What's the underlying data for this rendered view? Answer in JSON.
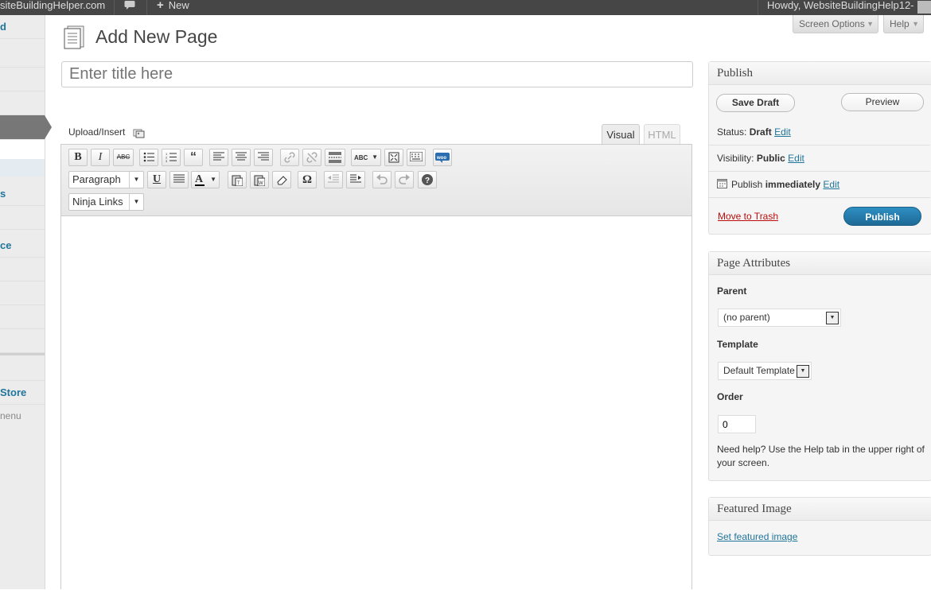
{
  "adminbar": {
    "site": "siteBuildingHelper.com",
    "new_label": "New",
    "howdy": "Howdy, WebsiteBuildingHelp12-"
  },
  "sidebar": {
    "items": [
      {
        "label": "d"
      },
      {
        "label": "s"
      },
      {
        "label": "ce"
      },
      {
        "label": "Store"
      },
      {
        "label": "nenu"
      }
    ]
  },
  "page": {
    "title": "Add New Page",
    "screen_options": "Screen Options",
    "help": "Help",
    "title_placeholder": "Enter title here"
  },
  "editor": {
    "upload_insert": "Upload/Insert",
    "tab_visual": "Visual",
    "tab_html": "HTML",
    "format_select": "Paragraph",
    "ninja_links": "Ninja Links",
    "toolbar_row1": [
      "bold-icon",
      "italic-icon",
      "strikethrough-icon",
      "bullet-list-icon",
      "numbered-list-icon",
      "blockquote-icon",
      "align-left-icon",
      "align-center-icon",
      "align-right-icon",
      "link-icon",
      "unlink-icon",
      "more-tag-icon",
      "spellcheck-icon",
      "fullscreen-icon",
      "kitchen-sink-icon",
      "woo-icon"
    ],
    "toolbar_row2": [
      "underline-icon",
      "justify-icon",
      "text-color-icon",
      "paste-text-icon",
      "paste-word-icon",
      "eraser-icon",
      "omega-icon",
      "outdent-icon",
      "indent-icon",
      "undo-icon",
      "redo-icon",
      "help-icon"
    ]
  },
  "publish": {
    "heading": "Publish",
    "save_draft": "Save Draft",
    "preview": "Preview",
    "status_label": "Status:",
    "status_value": "Draft",
    "visibility_label": "Visibility:",
    "visibility_value": "Public",
    "publish_label": "Publish",
    "publish_value": "immediately",
    "edit": "Edit",
    "move_to_trash": "Move to Trash",
    "publish_button": "Publish"
  },
  "attributes": {
    "heading": "Page Attributes",
    "parent_label": "Parent",
    "parent_value": "(no parent)",
    "template_label": "Template",
    "template_value": "Default Template",
    "order_label": "Order",
    "order_value": "0",
    "help_text": "Need help? Use the Help tab in the upper right of your screen."
  },
  "featured": {
    "heading": "Featured Image",
    "link": "Set featured image"
  },
  "colors": {
    "admin_bar": "#464646",
    "link": "#21759b",
    "publish_button": "#21759b",
    "trash": "#bc0b0b"
  }
}
